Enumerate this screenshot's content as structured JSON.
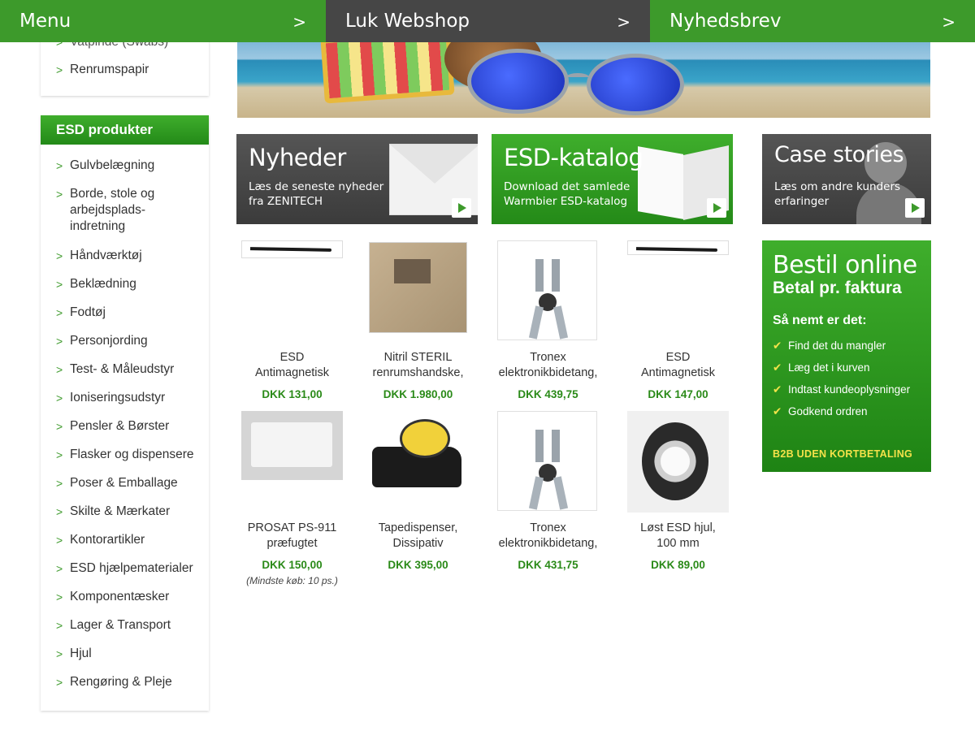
{
  "topnav": {
    "items": [
      {
        "label": "Menu",
        "arrow": ">"
      },
      {
        "label": "Luk Webshop",
        "arrow": ">"
      },
      {
        "label": "Nyhedsbrev",
        "arrow": ">"
      }
    ]
  },
  "sidebar_top": {
    "items": [
      {
        "label": "Vatpinde (Swabs)"
      },
      {
        "label": "Renrumspapir"
      }
    ]
  },
  "sidebar": {
    "header": "ESD produkter",
    "chevron": ">",
    "items": [
      {
        "label": "Gulvbelægning"
      },
      {
        "label": "Borde, stole og arbejdsplads-indretning"
      },
      {
        "label": "Håndværktøj"
      },
      {
        "label": "Beklædning"
      },
      {
        "label": "Fodtøj"
      },
      {
        "label": "Personjording"
      },
      {
        "label": "Test- & Måleudstyr"
      },
      {
        "label": "Ioniseringsudstyr"
      },
      {
        "label": "Pensler & Børster"
      },
      {
        "label": "Flasker og dispensere"
      },
      {
        "label": "Poser & Emballage"
      },
      {
        "label": "Skilte & Mærkater"
      },
      {
        "label": "Kontorartikler"
      },
      {
        "label": "ESD hjælpematerialer"
      },
      {
        "label": "Komponentæsker"
      },
      {
        "label": "Lager & Transport"
      },
      {
        "label": "Hjul"
      },
      {
        "label": "Rengøring & Pleje"
      }
    ]
  },
  "promos": [
    {
      "title": "Nyheder",
      "text": "Læs de seneste nyheder fra ZENITECH"
    },
    {
      "title": "ESD-katalog",
      "text": "Download det samlede Warmbier ESD-katalog"
    },
    {
      "title": "Case stories",
      "text": "Læs om andre kunders erfaringer"
    }
  ],
  "products": [
    {
      "name1": "ESD",
      "name2": "Antimagnetisk",
      "price": "DKK 131,00",
      "note": ""
    },
    {
      "name1": "Nitril STERIL",
      "name2": "renrumshandske,",
      "price": "DKK 1.980,00",
      "note": ""
    },
    {
      "name1": "Tronex",
      "name2": "elektronikbidetang,",
      "price": "DKK 439,75",
      "note": ""
    },
    {
      "name1": "ESD",
      "name2": "Antimagnetisk",
      "price": "DKK 147,00",
      "note": ""
    },
    {
      "name1": "PROSAT PS-911",
      "name2": "præfugtet",
      "price": "DKK 150,00",
      "note": "(Mindste køb: 10 ps.)"
    },
    {
      "name1": "Tapedispenser,",
      "name2": "Dissipativ",
      "price": "DKK 395,00",
      "note": ""
    },
    {
      "name1": "Tronex",
      "name2": "elektronikbidetang,",
      "price": "DKK 431,75",
      "note": ""
    },
    {
      "name1": "Løst ESD hjul,",
      "name2": "100 mm",
      "price": "DKK 89,00",
      "note": ""
    }
  ],
  "order_box": {
    "title": "Bestil online",
    "subtitle": "Betal pr. faktura",
    "how": "Så nemt er det:",
    "steps": [
      "Find det du mangler",
      "Læg det i kurven",
      "Indtast kundeoplysninger",
      "Godkend ordren"
    ],
    "check": "✔",
    "b2b": "B2B UDEN KORTBETALING"
  },
  "colors": {
    "brand_green": "#3d9a2b",
    "dark_gray": "#464646",
    "price_green": "#2a8a18",
    "accent_yellow": "#f5e24a"
  }
}
